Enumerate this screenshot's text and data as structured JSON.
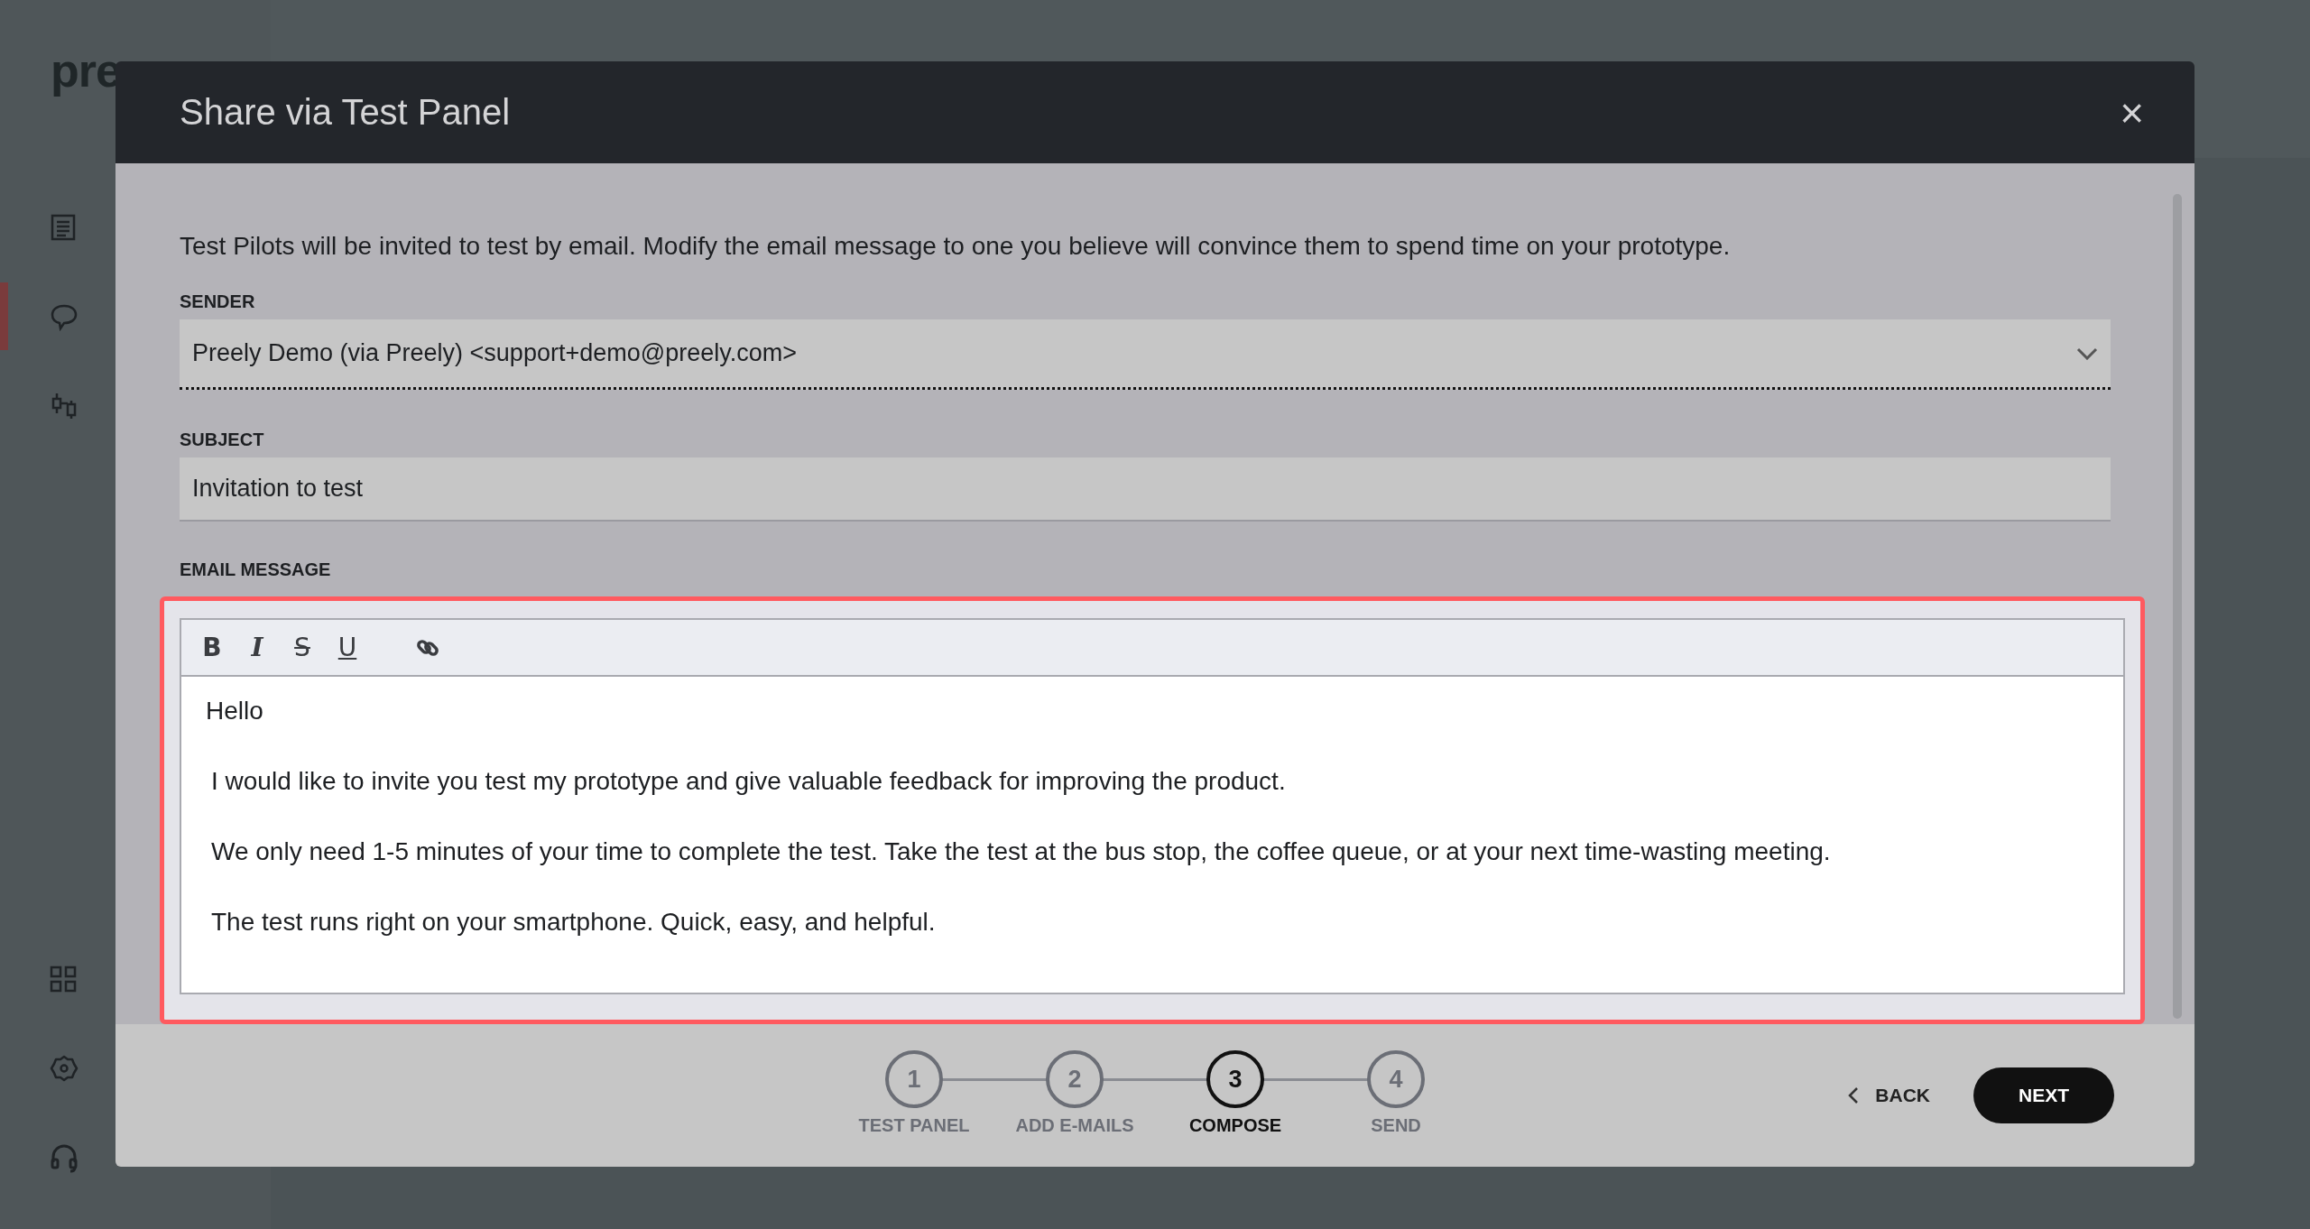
{
  "app": {
    "logo": "pre",
    "nav": [
      {
        "kind": "document",
        "selected": false
      },
      {
        "kind": "chat",
        "selected": true
      },
      {
        "kind": "sliders",
        "selected": false
      },
      {
        "kind": "grid",
        "selected": false
      },
      {
        "kind": "settings",
        "selected": false
      },
      {
        "kind": "headset",
        "selected": false
      }
    ]
  },
  "dialog": {
    "title": "Share via Test Panel",
    "close": "×",
    "intro": "Test Pilots will be invited to test by email. Modify the email message to one you believe will convince them to spend time on your prototype.",
    "sender": {
      "label": "SENDER",
      "value": "Preely Demo (via Preely) <support+demo@preely.com>"
    },
    "subject": {
      "label": "SUBJECT",
      "value": "Invitation to test"
    },
    "message": {
      "label": "EMAIL MESSAGE",
      "highlighted": true,
      "toolbar": [
        {
          "kind": "bold",
          "label": "B"
        },
        {
          "kind": "italic",
          "label": "I"
        },
        {
          "kind": "strike",
          "label": "S"
        },
        {
          "kind": "underline",
          "label": "U"
        },
        {
          "kind": "link"
        }
      ],
      "paragraphs": [
        "Hello",
        "I would like to invite you test my prototype and give valuable feedback for improving the product.",
        "We only need 1-5 minutes of your time to complete the test. Take the test at the bus stop, the coffee queue, or at your next time-wasting meeting.",
        "The test runs right on your smartphone. Quick, easy, and helpful."
      ]
    },
    "steps": [
      {
        "number": "1",
        "label": "TEST PANEL",
        "selected": false
      },
      {
        "number": "2",
        "label": "ADD E-MAILS",
        "selected": false
      },
      {
        "number": "3",
        "label": "COMPOSE",
        "selected": true
      },
      {
        "number": "4",
        "label": "SEND",
        "selected": false
      }
    ],
    "back": "BACK",
    "next": "NEXT"
  }
}
